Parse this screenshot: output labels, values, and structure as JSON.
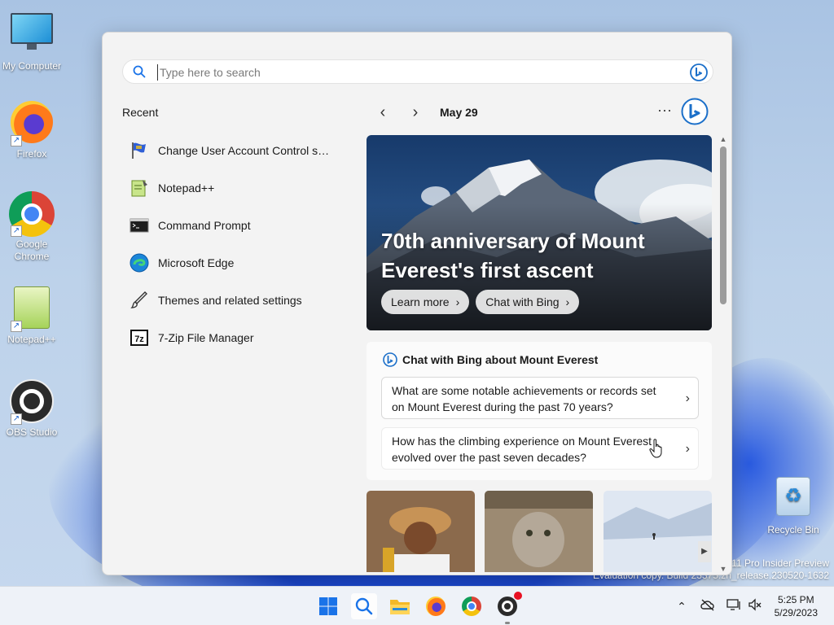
{
  "desktop": {
    "icons": [
      {
        "label": "My Computer"
      },
      {
        "label": "Firefox"
      },
      {
        "label": "Google Chrome"
      },
      {
        "label": "Notepad++"
      },
      {
        "label": "OBS Studio"
      },
      {
        "label": "Recycle Bin"
      }
    ],
    "watermark_line1": "11 Pro Insider Preview",
    "watermark_line2": "Evaluation copy. Build 23375.zn_release.230520-1632"
  },
  "search": {
    "placeholder": "Type here to search",
    "value": ""
  },
  "recent": {
    "title": "Recent",
    "items": [
      {
        "label": "Change User Account Control se...",
        "icon": "uac-flag-icon"
      },
      {
        "label": "Notepad++",
        "icon": "notepadpp-icon"
      },
      {
        "label": "Command Prompt",
        "icon": "cmd-icon"
      },
      {
        "label": "Microsoft Edge",
        "icon": "edge-icon"
      },
      {
        "label": "Themes and related settings",
        "icon": "brush-icon"
      },
      {
        "label": "7-Zip File Manager",
        "icon": "7zip-icon"
      }
    ]
  },
  "highlights": {
    "date": "May 29",
    "more": "···",
    "hero": {
      "title": "70th anniversary of Mount Everest's first ascent",
      "learn_more": "Learn more",
      "chat_with_bing": "Chat with Bing"
    },
    "chat": {
      "heading": "Chat with Bing about Mount Everest",
      "questions": [
        "What are some notable achievements or records set on Mount Everest during the past 70 years?",
        "How has the climbing experience on Mount Everest evolved over the past seven decades?"
      ]
    }
  },
  "taskbar": {
    "time": "5:25 PM",
    "date": "5/29/2023"
  },
  "colors": {
    "accent": "#1a73e8",
    "bing": "#1b6fc9",
    "panel_bg": "#f3f3f3"
  }
}
